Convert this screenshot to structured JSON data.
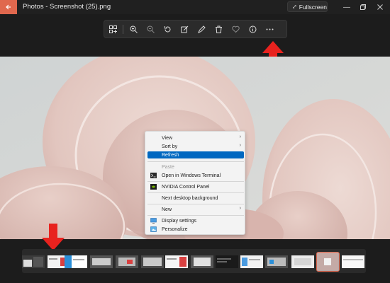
{
  "window": {
    "title": "Photos - Screenshot (25).png",
    "fullscreen_label": "Fullscreen",
    "accent": "#e0684e"
  },
  "toolbar": {
    "buttons": [
      "gallery-icon",
      "zoom-in-icon",
      "zoom-out-icon",
      "rotate-icon",
      "edit-icon",
      "draw-icon",
      "delete-icon",
      "favorite-icon",
      "info-icon",
      "more-icon"
    ]
  },
  "context_menu": {
    "items": [
      {
        "label": "View",
        "submenu": true
      },
      {
        "label": "Sort by",
        "submenu": true
      },
      {
        "label": "Refresh",
        "highlighted": true
      },
      {
        "label": "Paste",
        "disabled": true
      },
      {
        "label": "Open in Windows Terminal",
        "icon": "terminal-icon"
      },
      {
        "label": "NVIDIA Control Panel",
        "icon": "nvidia-icon"
      },
      {
        "label": "Next desktop background"
      },
      {
        "label": "New",
        "submenu": true
      },
      {
        "label": "Display settings",
        "icon": "display-icon"
      },
      {
        "label": "Personalize",
        "icon": "personalize-icon"
      }
    ],
    "highlight_color": "#0067c0"
  },
  "filmstrip": {
    "thumbnail_count": 14,
    "selected_index": 12
  },
  "annotations": {
    "arrow_color": "#e8221e"
  }
}
